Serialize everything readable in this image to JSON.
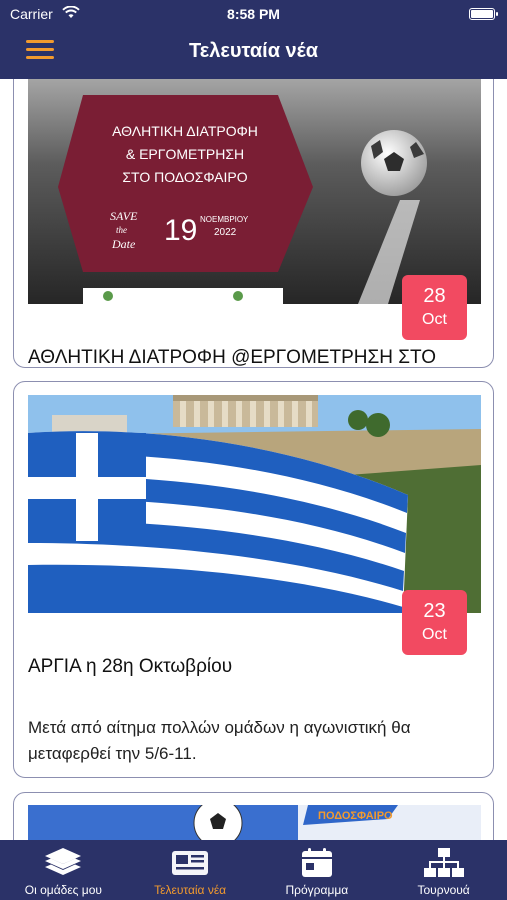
{
  "status_bar": {
    "carrier": "Carrier",
    "time": "8:58 PM"
  },
  "header": {
    "title": "Τελευταία νέα"
  },
  "news": [
    {
      "day": "28",
      "month": "Oct",
      "title": "ΑΘΛΗΤΙΚΗ ΔΙΑΤΡΟΦΗ @ΕΡΓΟΜΕΤΡΗΣΗ ΣΤΟ ΠΟΔΟΣΦΑΙΡΟ",
      "summary": "",
      "image_text": {
        "line1": "ΑΘΛΗΤΙΚΗ ΔΙΑΤΡΟΦΗ",
        "line2": "& ΕΡΓΟΜΕΤΡΗΣΗ",
        "line3": "ΣΤΟ ΠΟΔΟΣΦΑΙΡΟ",
        "save1": "SAVE",
        "save2": "the",
        "save3": "Date",
        "date_num": "19",
        "date_month": "ΝΟΕΜΒΡΙΟΥ",
        "date_year": "2022"
      }
    },
    {
      "day": "23",
      "month": "Oct",
      "title": "ΑΡΓΙΑ η 28η Οκτωβρίου",
      "summary": "Μετά από αίτημα πολλών ομάδων η αγωνιστική θα μεταφερθεί την 5/6-11."
    },
    {
      "image_text": "ΠΟΔΟΣΦΑΙΡΟ"
    }
  ],
  "tabs": [
    {
      "label": "Οι ομάδες μου",
      "icon": "layers-icon",
      "active": false
    },
    {
      "label": "Τελευταία νέα",
      "icon": "newspaper-icon",
      "active": true
    },
    {
      "label": "Πρόγραμμα",
      "icon": "calendar-icon",
      "active": false
    },
    {
      "label": "Τουρνουά",
      "icon": "sitemap-icon",
      "active": false
    }
  ],
  "colors": {
    "bar_bg": "#2b3268",
    "accent": "#f29a2e",
    "badge": "#f24a61",
    "poster_banner": "#7a1e34"
  }
}
